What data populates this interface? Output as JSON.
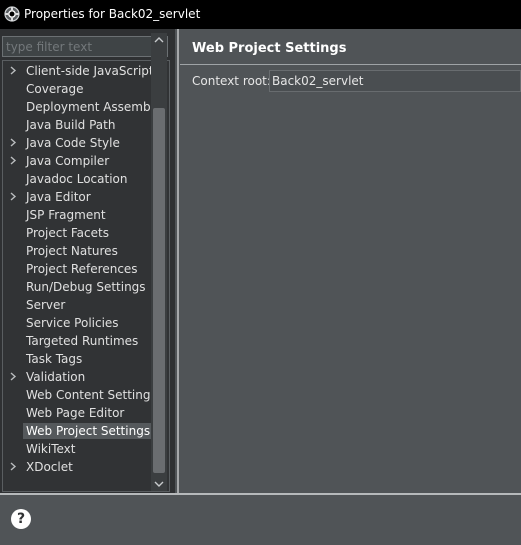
{
  "window": {
    "title": "Properties for Back02_servlet",
    "icon": "gear-icon"
  },
  "filter": {
    "placeholder": "type filter text",
    "value": ""
  },
  "tree": {
    "items": [
      {
        "label": "Client-side JavaScript",
        "expandable": true,
        "selected": false
      },
      {
        "label": "Coverage",
        "expandable": false,
        "selected": false
      },
      {
        "label": "Deployment Assembly",
        "expandable": false,
        "selected": false
      },
      {
        "label": "Java Build Path",
        "expandable": false,
        "selected": false
      },
      {
        "label": "Java Code Style",
        "expandable": true,
        "selected": false
      },
      {
        "label": "Java Compiler",
        "expandable": true,
        "selected": false
      },
      {
        "label": "Javadoc Location",
        "expandable": false,
        "selected": false
      },
      {
        "label": "Java Editor",
        "expandable": true,
        "selected": false
      },
      {
        "label": "JSP Fragment",
        "expandable": false,
        "selected": false
      },
      {
        "label": "Project Facets",
        "expandable": false,
        "selected": false
      },
      {
        "label": "Project Natures",
        "expandable": false,
        "selected": false
      },
      {
        "label": "Project References",
        "expandable": false,
        "selected": false
      },
      {
        "label": "Run/Debug Settings",
        "expandable": false,
        "selected": false
      },
      {
        "label": "Server",
        "expandable": false,
        "selected": false
      },
      {
        "label": "Service Policies",
        "expandable": false,
        "selected": false
      },
      {
        "label": "Targeted Runtimes",
        "expandable": false,
        "selected": false
      },
      {
        "label": "Task Tags",
        "expandable": false,
        "selected": false
      },
      {
        "label": "Validation",
        "expandable": true,
        "selected": false
      },
      {
        "label": "Web Content Settings",
        "expandable": false,
        "selected": false
      },
      {
        "label": "Web Page Editor",
        "expandable": false,
        "selected": false
      },
      {
        "label": "Web Project Settings",
        "expandable": false,
        "selected": true
      },
      {
        "label": "WikiText",
        "expandable": false,
        "selected": false
      },
      {
        "label": "XDoclet",
        "expandable": true,
        "selected": false
      }
    ]
  },
  "page": {
    "title": "Web Project Settings",
    "context_root_label": "Context root:",
    "context_root_value": "Back02_servlet"
  },
  "footer": {
    "help_label": "?"
  },
  "colors": {
    "titlebar": "#000000",
    "panel_bg": "#505457",
    "tree_bg": "#313335",
    "selection": "#55595c"
  }
}
